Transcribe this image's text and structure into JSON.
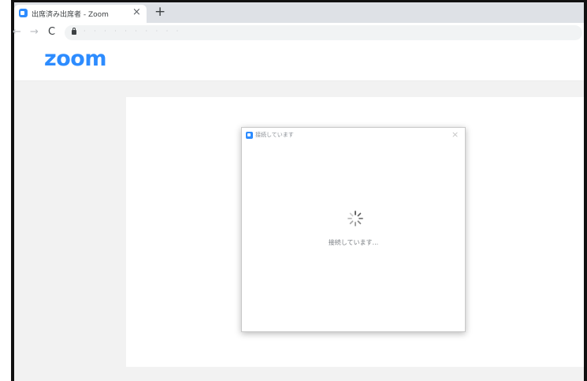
{
  "browser": {
    "tab": {
      "title": "出席済み出席者 - Zoom",
      "close_glyph": "×",
      "favicon": "zoom-favicon"
    },
    "new_tab_glyph": "+",
    "nav": {
      "back_glyph": "←",
      "forward_glyph": "→",
      "reload_glyph": "C"
    },
    "address_bar": {
      "text": "· · · · · · · · · ·",
      "lock_icon": "lock-icon"
    }
  },
  "site": {
    "logo_text": "zoom",
    "brand_color": "#2d8cff"
  },
  "dialog": {
    "title": "接続しています",
    "close_glyph": "×",
    "spinner_icon": "loading-spinner-icon",
    "status_text": "接続しています..."
  }
}
